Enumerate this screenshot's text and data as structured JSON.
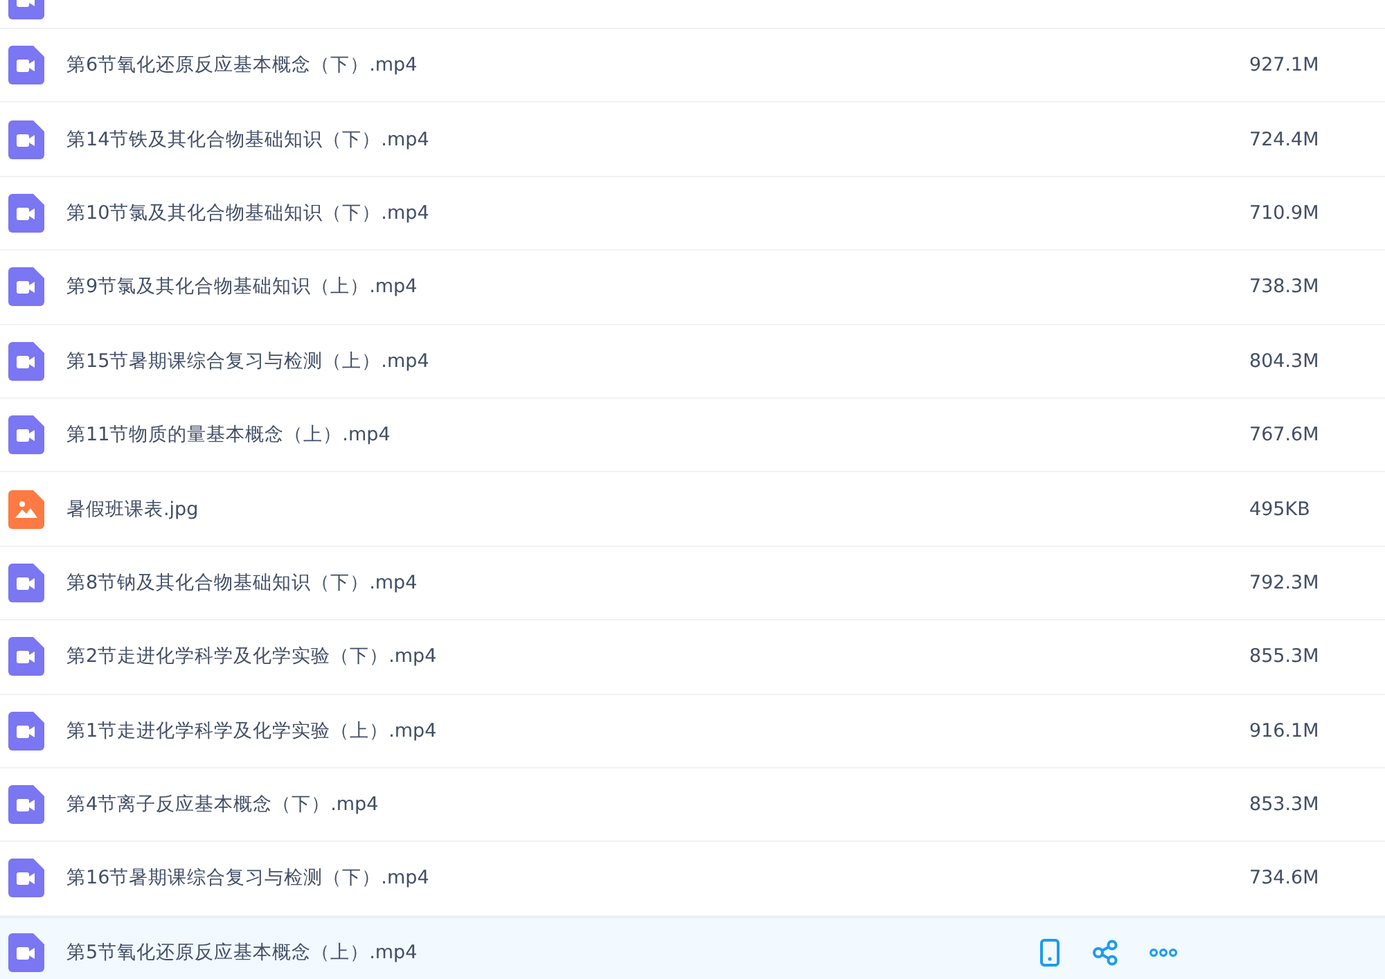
{
  "files": [
    {
      "kind": "video",
      "cut": true,
      "selected": false
    },
    {
      "kind": "video",
      "name": "第6节氧化还原反应基本概念（下）.mp4",
      "size": "927.1M",
      "selected": false
    },
    {
      "kind": "video",
      "name": "第14节铁及其化合物基础知识（下）.mp4",
      "size": "724.4M",
      "selected": false
    },
    {
      "kind": "video",
      "name": "第10节氯及其化合物基础知识（下）.mp4",
      "size": "710.9M",
      "selected": false
    },
    {
      "kind": "video",
      "name": "第9节氯及其化合物基础知识（上）.mp4",
      "size": "738.3M",
      "selected": false
    },
    {
      "kind": "video",
      "name": "第15节暑期课综合复习与检测（上）.mp4",
      "size": "804.3M",
      "selected": false
    },
    {
      "kind": "video",
      "name": "第11节物质的量基本概念（上）.mp4",
      "size": "767.6M",
      "selected": false
    },
    {
      "kind": "image",
      "name": "暑假班课表.jpg",
      "size": "495KB",
      "selected": false
    },
    {
      "kind": "video",
      "name": "第8节钠及其化合物基础知识（下）.mp4",
      "size": "792.3M",
      "selected": false
    },
    {
      "kind": "video",
      "name": "第2节走进化学科学及化学实验（下）.mp4",
      "size": "855.3M",
      "selected": false
    },
    {
      "kind": "video",
      "name": "第1节走进化学科学及化学实验（上）.mp4",
      "size": "916.1M",
      "selected": false
    },
    {
      "kind": "video",
      "name": "第4节离子反应基本概念（下）.mp4",
      "size": "853.3M",
      "selected": false
    },
    {
      "kind": "video",
      "name": "第16节暑期课综合复习与检测（下）.mp4",
      "size": "734.6M",
      "selected": false
    },
    {
      "kind": "video",
      "name": "第5节氧化还原反应基本概念（上）.mp4",
      "selected": true
    }
  ]
}
